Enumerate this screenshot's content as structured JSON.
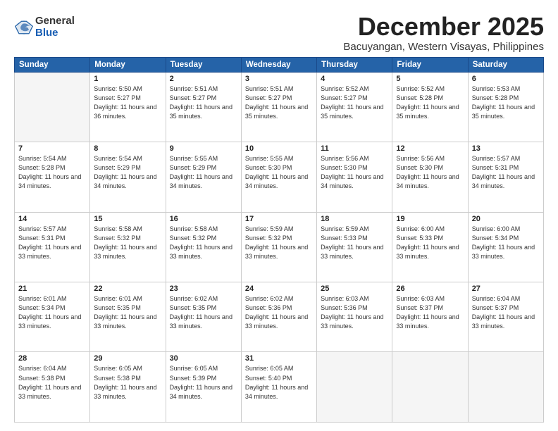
{
  "logo": {
    "general": "General",
    "blue": "Blue"
  },
  "header": {
    "month": "December 2025",
    "location": "Bacuyangan, Western Visayas, Philippines"
  },
  "weekdays": [
    "Sunday",
    "Monday",
    "Tuesday",
    "Wednesday",
    "Thursday",
    "Friday",
    "Saturday"
  ],
  "weeks": [
    [
      {
        "day": "",
        "info": ""
      },
      {
        "day": "1",
        "info": "Sunrise: 5:50 AM\nSunset: 5:27 PM\nDaylight: 11 hours\nand 36 minutes."
      },
      {
        "day": "2",
        "info": "Sunrise: 5:51 AM\nSunset: 5:27 PM\nDaylight: 11 hours\nand 35 minutes."
      },
      {
        "day": "3",
        "info": "Sunrise: 5:51 AM\nSunset: 5:27 PM\nDaylight: 11 hours\nand 35 minutes."
      },
      {
        "day": "4",
        "info": "Sunrise: 5:52 AM\nSunset: 5:27 PM\nDaylight: 11 hours\nand 35 minutes."
      },
      {
        "day": "5",
        "info": "Sunrise: 5:52 AM\nSunset: 5:28 PM\nDaylight: 11 hours\nand 35 minutes."
      },
      {
        "day": "6",
        "info": "Sunrise: 5:53 AM\nSunset: 5:28 PM\nDaylight: 11 hours\nand 35 minutes."
      }
    ],
    [
      {
        "day": "7",
        "info": "Sunrise: 5:54 AM\nSunset: 5:28 PM\nDaylight: 11 hours\nand 34 minutes."
      },
      {
        "day": "8",
        "info": "Sunrise: 5:54 AM\nSunset: 5:29 PM\nDaylight: 11 hours\nand 34 minutes."
      },
      {
        "day": "9",
        "info": "Sunrise: 5:55 AM\nSunset: 5:29 PM\nDaylight: 11 hours\nand 34 minutes."
      },
      {
        "day": "10",
        "info": "Sunrise: 5:55 AM\nSunset: 5:30 PM\nDaylight: 11 hours\nand 34 minutes."
      },
      {
        "day": "11",
        "info": "Sunrise: 5:56 AM\nSunset: 5:30 PM\nDaylight: 11 hours\nand 34 minutes."
      },
      {
        "day": "12",
        "info": "Sunrise: 5:56 AM\nSunset: 5:30 PM\nDaylight: 11 hours\nand 34 minutes."
      },
      {
        "day": "13",
        "info": "Sunrise: 5:57 AM\nSunset: 5:31 PM\nDaylight: 11 hours\nand 34 minutes."
      }
    ],
    [
      {
        "day": "14",
        "info": "Sunrise: 5:57 AM\nSunset: 5:31 PM\nDaylight: 11 hours\nand 33 minutes."
      },
      {
        "day": "15",
        "info": "Sunrise: 5:58 AM\nSunset: 5:32 PM\nDaylight: 11 hours\nand 33 minutes."
      },
      {
        "day": "16",
        "info": "Sunrise: 5:58 AM\nSunset: 5:32 PM\nDaylight: 11 hours\nand 33 minutes."
      },
      {
        "day": "17",
        "info": "Sunrise: 5:59 AM\nSunset: 5:32 PM\nDaylight: 11 hours\nand 33 minutes."
      },
      {
        "day": "18",
        "info": "Sunrise: 5:59 AM\nSunset: 5:33 PM\nDaylight: 11 hours\nand 33 minutes."
      },
      {
        "day": "19",
        "info": "Sunrise: 6:00 AM\nSunset: 5:33 PM\nDaylight: 11 hours\nand 33 minutes."
      },
      {
        "day": "20",
        "info": "Sunrise: 6:00 AM\nSunset: 5:34 PM\nDaylight: 11 hours\nand 33 minutes."
      }
    ],
    [
      {
        "day": "21",
        "info": "Sunrise: 6:01 AM\nSunset: 5:34 PM\nDaylight: 11 hours\nand 33 minutes."
      },
      {
        "day": "22",
        "info": "Sunrise: 6:01 AM\nSunset: 5:35 PM\nDaylight: 11 hours\nand 33 minutes."
      },
      {
        "day": "23",
        "info": "Sunrise: 6:02 AM\nSunset: 5:35 PM\nDaylight: 11 hours\nand 33 minutes."
      },
      {
        "day": "24",
        "info": "Sunrise: 6:02 AM\nSunset: 5:36 PM\nDaylight: 11 hours\nand 33 minutes."
      },
      {
        "day": "25",
        "info": "Sunrise: 6:03 AM\nSunset: 5:36 PM\nDaylight: 11 hours\nand 33 minutes."
      },
      {
        "day": "26",
        "info": "Sunrise: 6:03 AM\nSunset: 5:37 PM\nDaylight: 11 hours\nand 33 minutes."
      },
      {
        "day": "27",
        "info": "Sunrise: 6:04 AM\nSunset: 5:37 PM\nDaylight: 11 hours\nand 33 minutes."
      }
    ],
    [
      {
        "day": "28",
        "info": "Sunrise: 6:04 AM\nSunset: 5:38 PM\nDaylight: 11 hours\nand 33 minutes."
      },
      {
        "day": "29",
        "info": "Sunrise: 6:05 AM\nSunset: 5:38 PM\nDaylight: 11 hours\nand 33 minutes."
      },
      {
        "day": "30",
        "info": "Sunrise: 6:05 AM\nSunset: 5:39 PM\nDaylight: 11 hours\nand 34 minutes."
      },
      {
        "day": "31",
        "info": "Sunrise: 6:05 AM\nSunset: 5:40 PM\nDaylight: 11 hours\nand 34 minutes."
      },
      {
        "day": "",
        "info": ""
      },
      {
        "day": "",
        "info": ""
      },
      {
        "day": "",
        "info": ""
      }
    ]
  ]
}
